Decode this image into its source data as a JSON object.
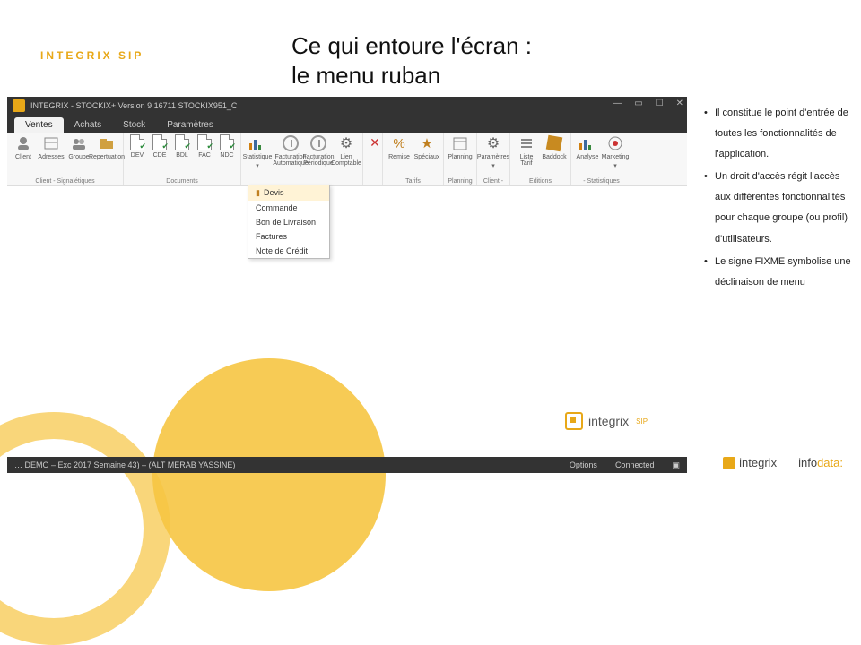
{
  "header": {
    "logo": "INTEGRIX SIP",
    "title_line1": "Ce qui entoure l'écran :",
    "title_line2": "le menu ruban"
  },
  "window_title": "INTEGRIX - STOCKIX+  Version 9   16711  STOCKIX951_C",
  "tabs": [
    "Ventes",
    "Achats",
    "Stock",
    "Paramètres"
  ],
  "ribbon": {
    "grp_client": {
      "label": "Client - Signalétiques",
      "items": [
        "Client",
        "Adresses",
        "Groupe",
        "Repertuation"
      ]
    },
    "grp_documents": {
      "label": "Documents",
      "items": [
        "DEV",
        "CDE",
        "BDL",
        "FAC",
        "NDC"
      ]
    },
    "grp_stats": {
      "label": "",
      "items": [
        "Statistique"
      ]
    },
    "grp_fact": {
      "label": "",
      "items": [
        "Facturation Automatique",
        "Facturation Périodique",
        "Lien Comptable"
      ]
    },
    "grp_empty": {
      "label": "",
      "items": [
        ""
      ]
    },
    "grp_tarifs": {
      "label": "Tarifs",
      "items": [
        "Remise",
        "Spéciaux"
      ]
    },
    "grp_planning": {
      "label": "Planning",
      "items": [
        "Planning"
      ]
    },
    "grp_client2": {
      "label": "Client -",
      "items": [
        "Paramètres"
      ]
    },
    "grp_editions": {
      "label": "Editions",
      "items": [
        "Liste Tarif",
        "Baddock"
      ]
    },
    "grp_stats2": {
      "label": "- Statistiques",
      "items": [
        "Analyse",
        "Marketing"
      ]
    }
  },
  "dropdown": {
    "items": [
      "Devis",
      "Commande",
      "Bon de Livraison",
      "Factures",
      "Note de Crédit"
    ]
  },
  "statusbar": {
    "left": "… DEMO – Exc 2017 Semaine 43) – (ALT MERAB YASSINE)",
    "opt": "Options",
    "conn": "Connected"
  },
  "bullets": [
    "Il constitue le point d'entrée de toutes les fonctionnalités de l'application.",
    "Un droit d'accès régit l'accès aux différentes fonctionnalités pour chaque groupe (ou profil) d'utilisateurs.",
    "Le signe FIXME symbolise une déclinaison de menu"
  ],
  "mid_logo": {
    "text": "integrix",
    "sup": "SIP"
  },
  "footer": {
    "ix": "integrix",
    "info_a": "info",
    "info_b": "data"
  }
}
